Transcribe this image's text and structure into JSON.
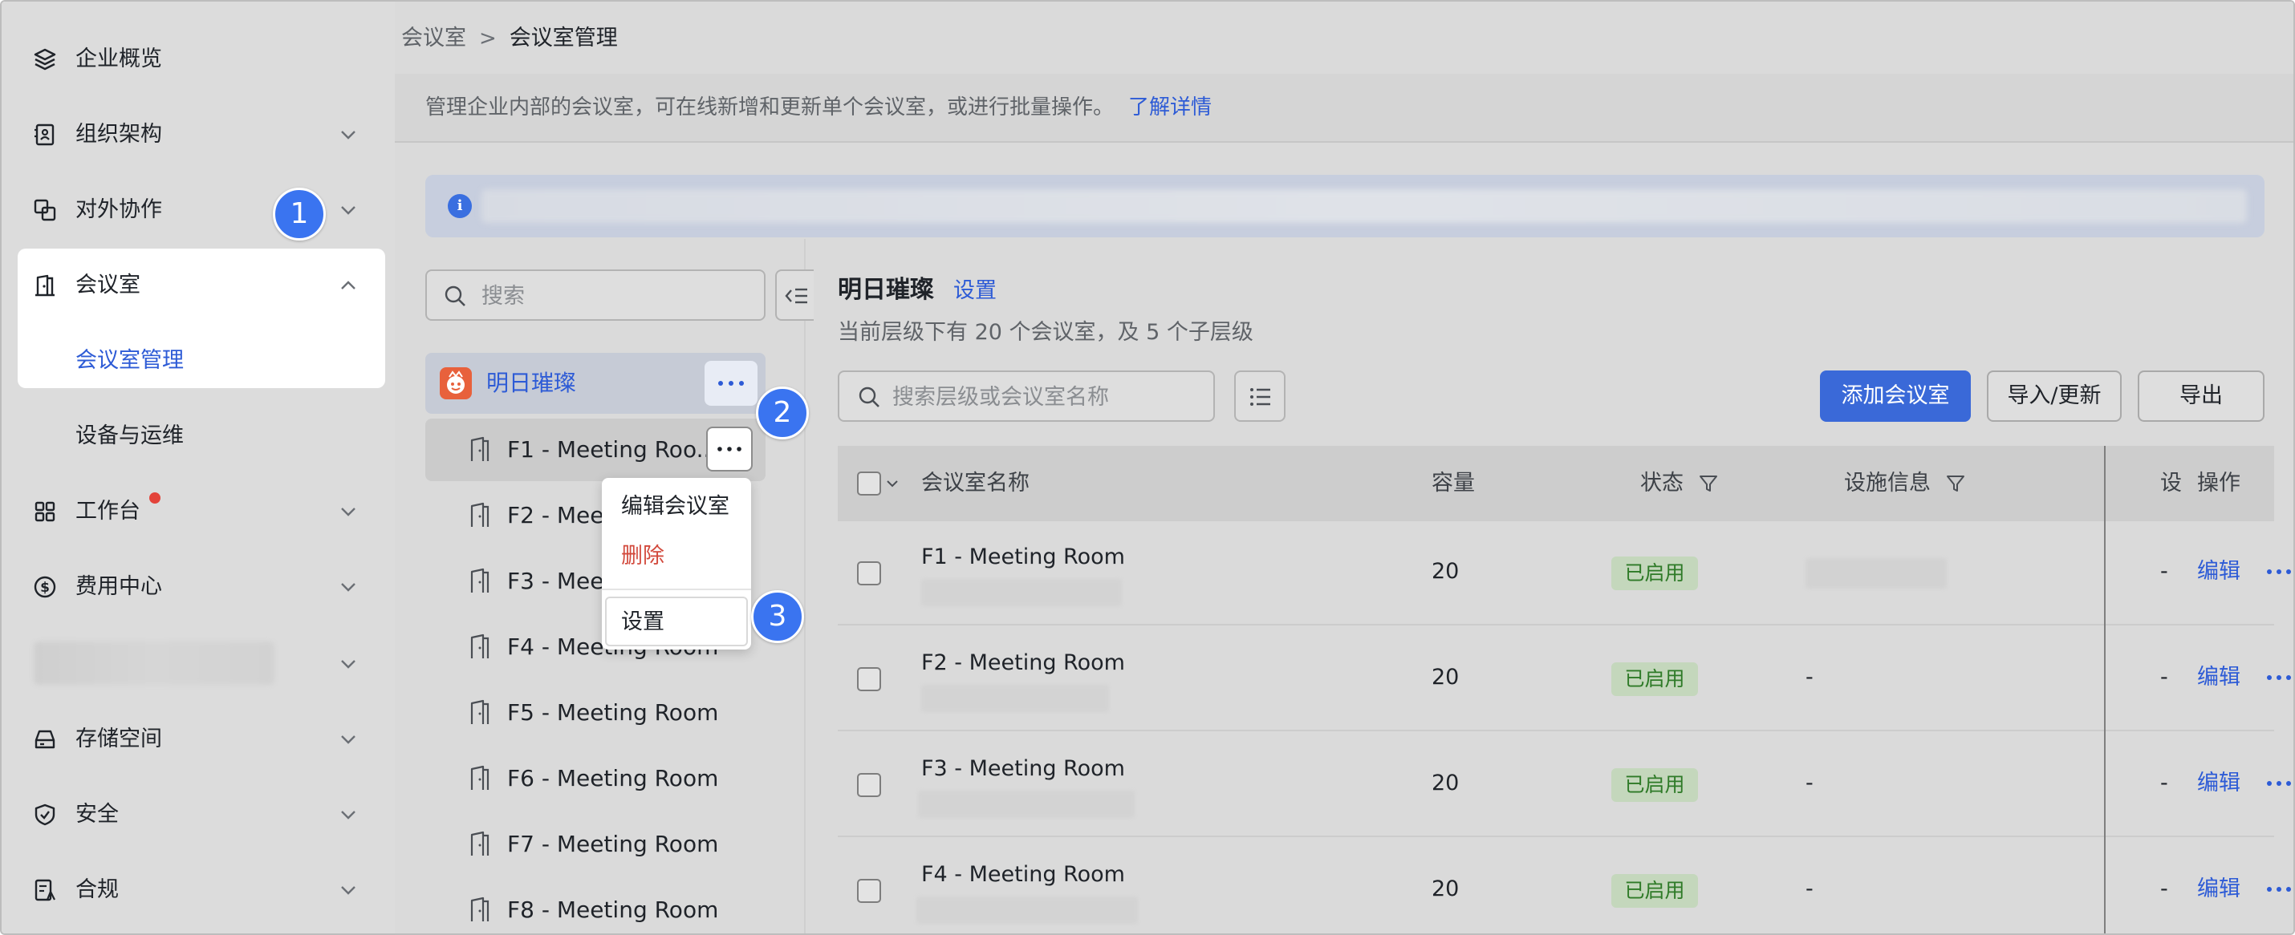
{
  "sidebar": {
    "items": [
      {
        "label": "企业概览",
        "icon": "layers-icon"
      },
      {
        "label": "组织架构",
        "icon": "org-chart-icon"
      },
      {
        "label": "对外协作",
        "icon": "external-collab-icon"
      },
      {
        "label": "会议室",
        "icon": "door-icon"
      },
      {
        "label": "工作台",
        "icon": "grid-apps-icon"
      },
      {
        "label": "费用中心",
        "icon": "dollar-icon"
      },
      {
        "label": "存储空间",
        "icon": "storage-icon"
      },
      {
        "label": "安全",
        "icon": "shield-icon"
      },
      {
        "label": "合规",
        "icon": "compliance-icon"
      }
    ],
    "meeting_room_sub": [
      "会议室管理",
      "设备与运维"
    ]
  },
  "steps": [
    "1",
    "2",
    "3"
  ],
  "breadcrumb": {
    "parent": "会议室",
    "separator": ">",
    "current": "会议室管理"
  },
  "description": {
    "text": "管理企业内部的会议室，可在线新增和更新单个会议室，或进行批量操作。",
    "link": "了解详情"
  },
  "tree": {
    "search_placeholder": "搜索",
    "root": "明日璀璨",
    "items": [
      "F1 - Meeting Roo...",
      "F2 - Mee",
      "F3 - Mee",
      "F4 - Meeting Room",
      "F5 - Meeting Room",
      "F6 - Meeting Room",
      "F7 - Meeting Room",
      "F8 - Meeting Room"
    ]
  },
  "context_menu": {
    "edit": "编辑会议室",
    "delete": "删除",
    "settings": "设置"
  },
  "detail": {
    "title": "明日璀璨",
    "settings_link": "设置",
    "subtitle": "当前层级下有 20 个会议室，及 5 个子层级",
    "search_placeholder": "搜索层级或会议室名称",
    "add_button": "添加会议室",
    "import_button": "导入/更新",
    "export_button": "导出"
  },
  "table": {
    "headers": {
      "name": "会议室名称",
      "capacity": "容量",
      "status": "状态",
      "facility": "设施信息",
      "extra": "设",
      "actions": "操作"
    },
    "rows": [
      {
        "name": "F1 - Meeting Room",
        "capacity": "20",
        "status": "已启用",
        "facility": "",
        "extra": "-",
        "edit": "编辑"
      },
      {
        "name": "F2 - Meeting Room",
        "capacity": "20",
        "status": "已启用",
        "facility": "-",
        "extra": "-",
        "edit": "编辑"
      },
      {
        "name": "F3 - Meeting Room",
        "capacity": "20",
        "status": "已启用",
        "facility": "-",
        "extra": "-",
        "edit": "编辑"
      },
      {
        "name": "F4 - Meeting Room",
        "capacity": "20",
        "status": "已启用",
        "facility": "-",
        "extra": "-",
        "edit": "编辑"
      }
    ]
  },
  "colors": {
    "accent": "#2d5bd6",
    "primary_button": "#3a69d8",
    "status_green": "#2e7a27",
    "badge_blue": "#3a74f0",
    "danger": "#d2493c"
  }
}
